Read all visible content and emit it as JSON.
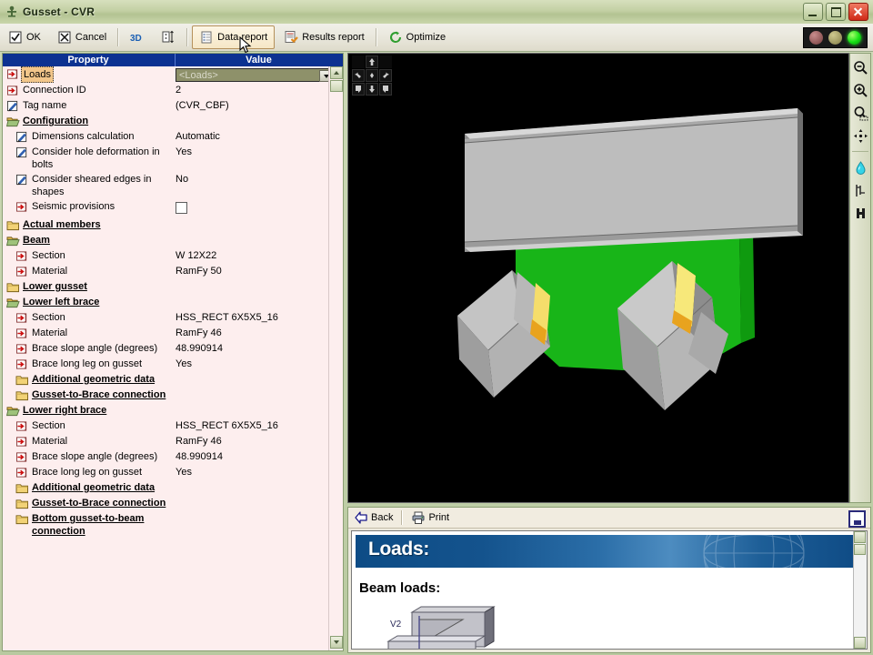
{
  "window": {
    "title": "Gusset - CVR",
    "icon": "gusset-app-icon",
    "buttons": {
      "minimize": "Minimize",
      "maximize": "Maximize",
      "close": "Close"
    }
  },
  "toolbar": {
    "items": [
      {
        "label": "OK",
        "icon": "checkbox-checked-icon",
        "hover": false
      },
      {
        "label": "Cancel",
        "icon": "checkbox-crossed-icon",
        "hover": false
      },
      {
        "label": "",
        "icon": "3d-icon",
        "hover": false
      },
      {
        "label": "",
        "icon": "dimensions-icon",
        "hover": false
      },
      {
        "label": "Data report",
        "icon": "document-icon",
        "hover": true
      },
      {
        "label": "Results report",
        "icon": "document-check-icon",
        "hover": false
      },
      {
        "label": "Optimize",
        "icon": "refresh-circle-icon",
        "hover": false
      }
    ],
    "status_lights": [
      {
        "name": "status-light-red",
        "color": "#8e5555",
        "on": false
      },
      {
        "name": "status-light-yellow",
        "color": "#9a945c",
        "on": false
      },
      {
        "name": "status-light-green",
        "color": "#14e014",
        "on": true
      }
    ]
  },
  "property_grid": {
    "columns": {
      "property": "Property",
      "value": "Value"
    },
    "rows": [
      {
        "label": "Loads",
        "value": "",
        "icon": "red-arrow-icon",
        "indent": 0,
        "type": "combo",
        "selected": true,
        "combo_value": "<Loads>"
      },
      {
        "label": "Connection ID",
        "value": "2",
        "icon": "red-arrow-icon",
        "indent": 0,
        "type": "text"
      },
      {
        "label": "Tag name",
        "value": "(CVR_CBF)",
        "icon": "edit-icon",
        "indent": 0,
        "type": "text"
      },
      {
        "label": "Configuration",
        "value": "",
        "icon": "folder-open-icon",
        "indent": 0,
        "type": "group"
      },
      {
        "label": "Dimensions calculation",
        "value": "Automatic",
        "icon": "edit-icon",
        "indent": 1,
        "type": "text"
      },
      {
        "label": "Consider hole deformation in bolts",
        "value": "Yes",
        "icon": "edit-icon",
        "indent": 1,
        "type": "text"
      },
      {
        "label": "Consider sheared edges in shapes",
        "value": "No",
        "icon": "edit-icon",
        "indent": 1,
        "type": "text"
      },
      {
        "label": "Seismic provisions",
        "value": "",
        "icon": "red-arrow-icon",
        "indent": 1,
        "type": "checkbox",
        "checked": false
      },
      {
        "label": "Actual members",
        "value": "",
        "icon": "folder-closed-icon",
        "indent": 0,
        "type": "group"
      },
      {
        "label": "Beam",
        "value": "",
        "icon": "folder-open-icon",
        "indent": 0,
        "type": "group"
      },
      {
        "label": "Section",
        "value": "W 12X22",
        "icon": "red-arrow-icon",
        "indent": 1,
        "type": "text"
      },
      {
        "label": "Material",
        "value": "RamFy 50",
        "icon": "red-arrow-icon",
        "indent": 1,
        "type": "text"
      },
      {
        "label": "Lower gusset",
        "value": "",
        "icon": "folder-closed-icon",
        "indent": 0,
        "type": "group"
      },
      {
        "label": "Lower left brace",
        "value": "",
        "icon": "folder-open-icon",
        "indent": 0,
        "type": "group"
      },
      {
        "label": "Section",
        "value": "HSS_RECT 6X5X5_16",
        "icon": "red-arrow-icon",
        "indent": 1,
        "type": "text"
      },
      {
        "label": "Material",
        "value": "RamFy 46",
        "icon": "red-arrow-icon",
        "indent": 1,
        "type": "text"
      },
      {
        "label": "Brace slope angle (degrees)",
        "value": "48.990914",
        "icon": "red-arrow-icon",
        "indent": 1,
        "type": "text"
      },
      {
        "label": "Brace long leg on gusset",
        "value": "Yes",
        "icon": "red-arrow-icon",
        "indent": 1,
        "type": "text"
      },
      {
        "label": "Additional geometric data",
        "value": "",
        "icon": "folder-closed-icon",
        "indent": 1,
        "type": "group"
      },
      {
        "label": "Gusset-to-Brace connection",
        "value": "",
        "icon": "folder-closed-icon",
        "indent": 1,
        "type": "group"
      },
      {
        "label": "Lower right brace",
        "value": "",
        "icon": "folder-open-icon",
        "indent": 0,
        "type": "group"
      },
      {
        "label": "Section",
        "value": "HSS_RECT 6X5X5_16",
        "icon": "red-arrow-icon",
        "indent": 1,
        "type": "text"
      },
      {
        "label": "Material",
        "value": "RamFy 46",
        "icon": "red-arrow-icon",
        "indent": 1,
        "type": "text"
      },
      {
        "label": "Brace slope angle (degrees)",
        "value": "48.990914",
        "icon": "red-arrow-icon",
        "indent": 1,
        "type": "text"
      },
      {
        "label": "Brace long leg on gusset",
        "value": "Yes",
        "icon": "red-arrow-icon",
        "indent": 1,
        "type": "text"
      },
      {
        "label": "Additional geometric data",
        "value": "",
        "icon": "folder-closed-icon",
        "indent": 1,
        "type": "group"
      },
      {
        "label": "Gusset-to-Brace connection",
        "value": "",
        "icon": "folder-closed-icon",
        "indent": 1,
        "type": "group"
      },
      {
        "label": "Bottom gusset-to-beam connection",
        "value": "",
        "icon": "folder-closed-icon",
        "indent": 1,
        "type": "group"
      }
    ]
  },
  "viewport": {
    "background": "#000000",
    "nav_cube": [
      "blank",
      "view-top-icon",
      "blank",
      "view-iso-left-icon",
      "view-front-icon",
      "view-iso-right-icon",
      "view-corner-bl-icon",
      "view-bottom-icon",
      "view-corner-br-icon"
    ],
    "model": {
      "beam_color": "#b3b3b3",
      "gusset_color": "#1fbf1f",
      "brace_color": "#b0b0b0",
      "weld_color": "#ffe680"
    },
    "tools": [
      "zoom-out-icon",
      "zoom-in-icon",
      "zoom-window-icon",
      "pan-icon",
      "water-drop-icon",
      "measure-icon",
      "section-icon"
    ]
  },
  "report": {
    "back_label": "Back",
    "print_label": "Print",
    "maximize_label": "Maximize",
    "banner_title": "Loads:",
    "section_title": "Beam loads:",
    "figure_label": "V2",
    "banner_color": "#0d4c86"
  }
}
